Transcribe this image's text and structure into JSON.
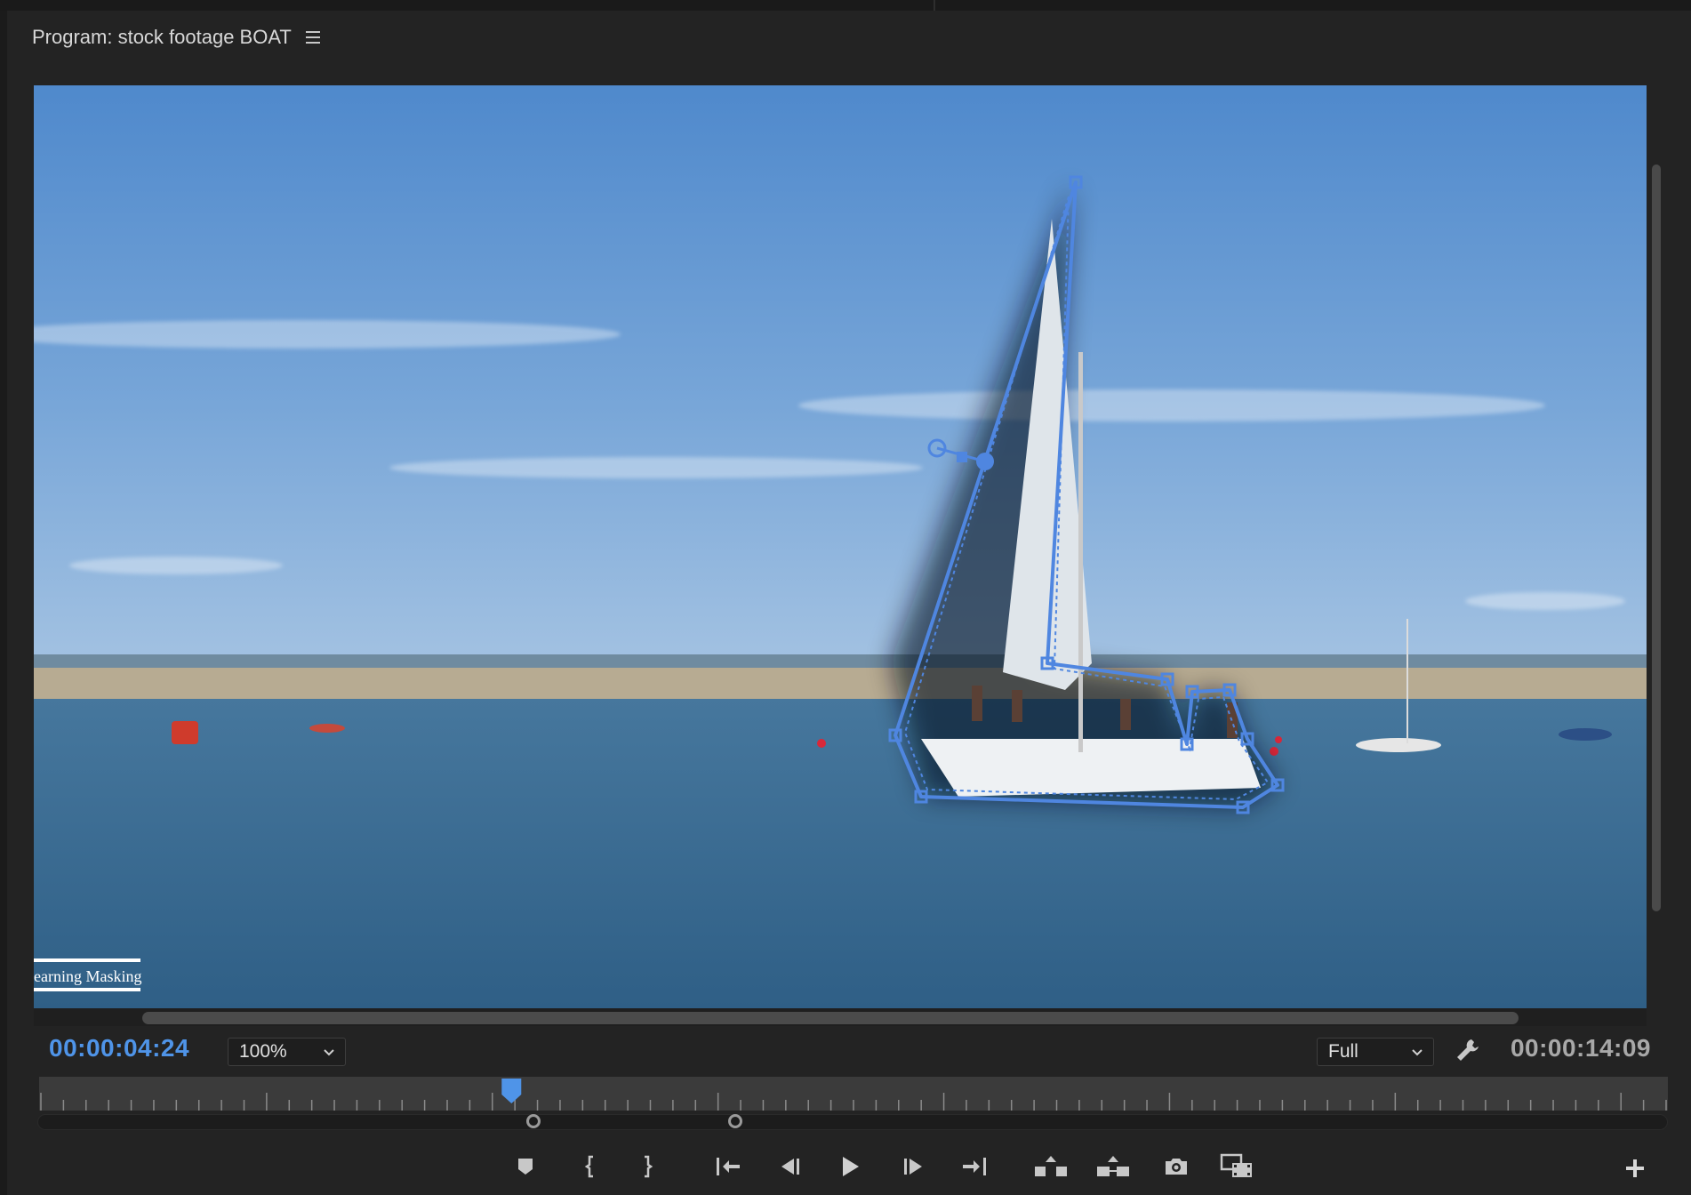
{
  "panel": {
    "title": "Program: stock footage BOAT",
    "menu_icon": "hamburger-menu-icon"
  },
  "viewer": {
    "watermark": "earning Masking",
    "mask_color": "#4f86e0",
    "sky_color": "#5b92d0",
    "water_color": "#3f6f92"
  },
  "timecode": {
    "current": "00:00:04:24",
    "duration": "00:00:14:09",
    "accent": "#4f94e8"
  },
  "zoom": {
    "selected": "100%"
  },
  "resolution": {
    "selected": "Full"
  },
  "playhead": {
    "position": 0.29
  },
  "controls": {
    "buttons": [
      {
        "name": "add-marker-button",
        "icon": "marker-icon"
      },
      {
        "name": "mark-in-button",
        "icon": "mark-in-icon"
      },
      {
        "name": "mark-out-button",
        "icon": "mark-out-icon"
      },
      {
        "name": "go-to-in-button",
        "icon": "go-to-in-icon"
      },
      {
        "name": "step-back-button",
        "icon": "step-back-icon"
      },
      {
        "name": "play-button",
        "icon": "play-icon"
      },
      {
        "name": "step-forward-button",
        "icon": "step-forward-icon"
      },
      {
        "name": "go-to-out-button",
        "icon": "go-to-out-icon"
      },
      {
        "name": "lift-button",
        "icon": "lift-icon"
      },
      {
        "name": "extract-button",
        "icon": "extract-icon"
      },
      {
        "name": "export-frame-button",
        "icon": "camera-icon"
      },
      {
        "name": "comparison-view-button",
        "icon": "comparison-icon"
      }
    ],
    "add_button_icon": "plus-icon"
  }
}
